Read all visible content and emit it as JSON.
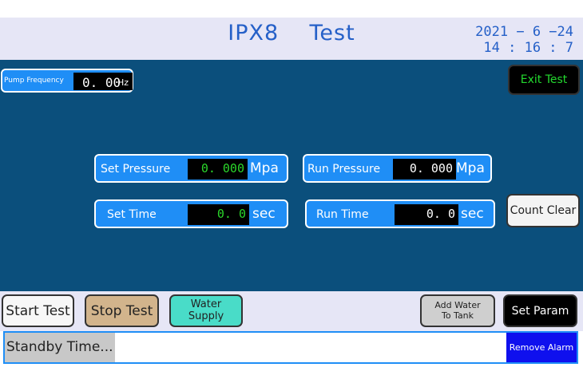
{
  "header": {
    "title": "IPX8    Test",
    "date": "2021 − 6 −24",
    "time": "14 : 16 : 7"
  },
  "pump": {
    "label": "Pump Frequency",
    "value": "0. 00",
    "unit": "Hz"
  },
  "exit_test": "Exit Test",
  "params": {
    "set_pressure": {
      "label": "Set Pressure",
      "value": "0. 000",
      "unit": "Mpa"
    },
    "run_pressure": {
      "label": "Run Pressure",
      "value": "0. 000",
      "unit": "Mpa"
    },
    "set_time": {
      "label": "Set Time",
      "value": "0. 0",
      "unit": "sec"
    },
    "run_time": {
      "label": "Run Time",
      "value": "0. 0",
      "unit": "sec"
    }
  },
  "count_clear": "Count Clear",
  "buttons": {
    "start_test": "Start Test",
    "stop_test": "Stop Test",
    "water_supply": "Water Supply",
    "add_water": "Add Water To Tank",
    "set_param": "Set Param"
  },
  "status": {
    "text": "Standby Time...",
    "remove_alarm": "Remove Alarm"
  },
  "colors": {
    "panel": "#0b4f7c",
    "accent": "#1f8ef6",
    "value_green": "#2bd62b"
  }
}
